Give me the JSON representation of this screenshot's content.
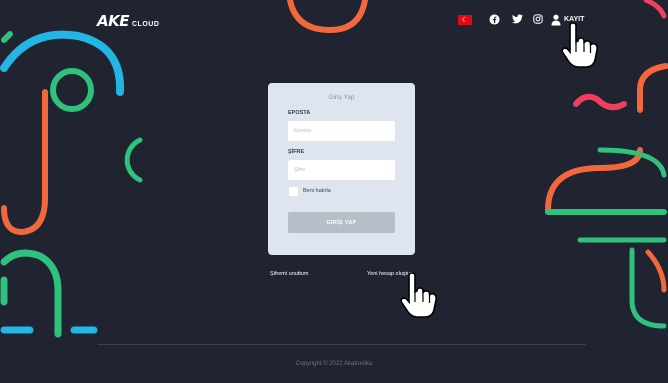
{
  "header": {
    "logo_text": "AKE",
    "logo_sub": "CLOUD",
    "flag": "tr-flag",
    "social": [
      {
        "name": "facebook-icon",
        "glyph": "f"
      },
      {
        "name": "twitter-icon",
        "glyph": "t"
      },
      {
        "name": "instagram-icon",
        "glyph": "◎"
      }
    ],
    "user_link": "KAYIT"
  },
  "login": {
    "title": "Giriş Yap",
    "email_label": "EPOSTA",
    "email_placeholder": "Eposta",
    "password_label": "ŞİFRE",
    "password_placeholder": "Şifre",
    "remember_label": "Beni hatırla",
    "submit_label": "GİRİŞ YAP"
  },
  "links": {
    "forgot": "Şifremi unuttum",
    "register": "Yeni hesap oluştur"
  },
  "footer": {
    "copyright": "Copyright © 2022 Akatronika"
  },
  "colors": {
    "background": "#1f2430",
    "card": "#dfe5ee",
    "orange": "#f2673b",
    "green": "#2ec27e",
    "blue": "#22b5e6",
    "pink": "#f0405d"
  }
}
